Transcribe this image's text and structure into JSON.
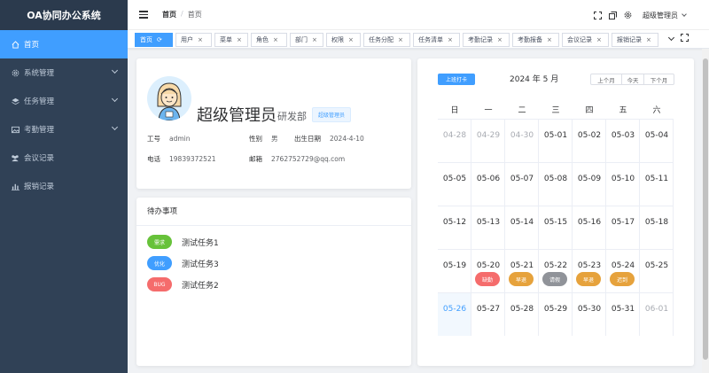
{
  "app": {
    "title": "OA协同办公系统"
  },
  "sidebar": {
    "items": [
      {
        "label": "首页",
        "icon": "home-icon",
        "active": true,
        "has_children": false
      },
      {
        "label": "系统管理",
        "icon": "gear-icon",
        "active": false,
        "has_children": true
      },
      {
        "label": "任务管理",
        "icon": "layers-icon",
        "active": false,
        "has_children": true
      },
      {
        "label": "考勤管理",
        "icon": "image-icon",
        "active": false,
        "has_children": true
      },
      {
        "label": "会议记录",
        "icon": "people-icon",
        "active": false,
        "has_children": false
      },
      {
        "label": "报销记录",
        "icon": "chart-icon",
        "active": false,
        "has_children": false
      }
    ]
  },
  "header": {
    "breadcrumb": [
      "首页",
      "首页"
    ],
    "user": "超级管理员"
  },
  "tags": [
    {
      "label": "首页",
      "active": true
    },
    {
      "label": "用户",
      "active": false
    },
    {
      "label": "菜单",
      "active": false
    },
    {
      "label": "角色",
      "active": false
    },
    {
      "label": "部门",
      "active": false
    },
    {
      "label": "权限",
      "active": false
    },
    {
      "label": "任务分配",
      "active": false
    },
    {
      "label": "任务清单",
      "active": false
    },
    {
      "label": "考勤记录",
      "active": false
    },
    {
      "label": "考勤报备",
      "active": false
    },
    {
      "label": "会议记录",
      "active": false
    },
    {
      "label": "报销记录",
      "active": false
    }
  ],
  "profile": {
    "name": "超级管理员",
    "department": "研发部",
    "role": "超级管理员",
    "id_label": "工号",
    "id_value": "admin",
    "gender_label": "性别",
    "gender_value": "男",
    "birth_label": "出生日期",
    "birth_value": "2024-4-10",
    "phone_label": "电话",
    "phone_value": "19839372521",
    "email_label": "邮箱",
    "email_value": "2762752729@qq.com"
  },
  "todo": {
    "title": "待办事项",
    "items": [
      {
        "tag": "需求",
        "color": "#67c23a",
        "text": "测试任务1"
      },
      {
        "tag": "优化",
        "color": "#409eff",
        "text": "测试任务3"
      },
      {
        "tag": "BUG",
        "color": "#f56c6c",
        "text": "测试任务2"
      }
    ]
  },
  "calendar": {
    "checkin_label": "上班打卡",
    "title": "2024 年 5 月",
    "nav": [
      "上个月",
      "今天",
      "下个月"
    ],
    "weekdays": [
      "日",
      "一",
      "二",
      "三",
      "四",
      "五",
      "六"
    ],
    "days": [
      {
        "d": "04-28",
        "other": true
      },
      {
        "d": "04-29",
        "other": true
      },
      {
        "d": "04-30",
        "other": true
      },
      {
        "d": "05-01"
      },
      {
        "d": "05-02"
      },
      {
        "d": "05-03"
      },
      {
        "d": "05-04"
      },
      {
        "d": "05-05"
      },
      {
        "d": "05-06"
      },
      {
        "d": "05-07"
      },
      {
        "d": "05-08"
      },
      {
        "d": "05-09"
      },
      {
        "d": "05-10"
      },
      {
        "d": "05-11"
      },
      {
        "d": "05-12"
      },
      {
        "d": "05-13"
      },
      {
        "d": "05-14"
      },
      {
        "d": "05-15"
      },
      {
        "d": "05-16"
      },
      {
        "d": "05-17"
      },
      {
        "d": "05-18"
      },
      {
        "d": "05-19"
      },
      {
        "d": "05-20",
        "badge": "缺勤",
        "color": "#f56c6c"
      },
      {
        "d": "05-21",
        "badge": "早退",
        "color": "#e6a23c"
      },
      {
        "d": "05-22",
        "badge": "请假",
        "color": "#909399"
      },
      {
        "d": "05-23",
        "badge": "早退",
        "color": "#e6a23c"
      },
      {
        "d": "05-24",
        "badge": "迟到",
        "color": "#e6a23c"
      },
      {
        "d": "05-25"
      },
      {
        "d": "05-26",
        "today": true
      },
      {
        "d": "05-27"
      },
      {
        "d": "05-28"
      },
      {
        "d": "05-29"
      },
      {
        "d": "05-30"
      },
      {
        "d": "05-31"
      },
      {
        "d": "06-01",
        "other": true
      }
    ]
  },
  "colors": {
    "primary": "#409eff",
    "sidebar_bg": "#304156",
    "sidebar_text": "#bfcbd9"
  }
}
